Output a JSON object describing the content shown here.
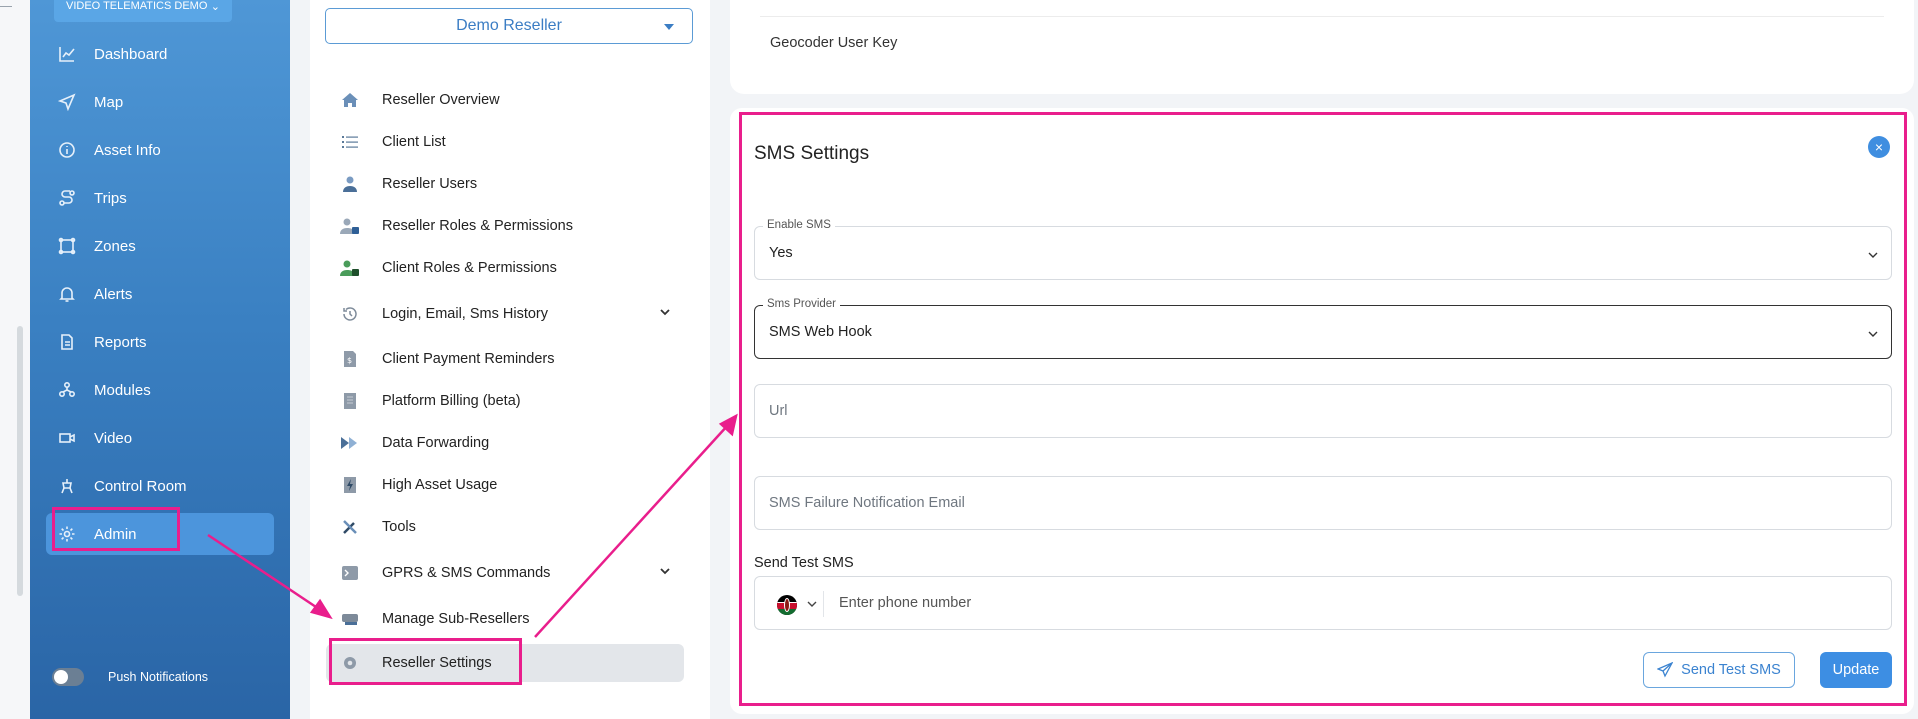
{
  "sidebar": {
    "top_select": "VIDEO TELEMATICS DEMO",
    "items": [
      {
        "label": "Dashboard",
        "icon": "chart-line-icon"
      },
      {
        "label": "Map",
        "icon": "navigation-icon"
      },
      {
        "label": "Asset Info",
        "icon": "info-icon"
      },
      {
        "label": "Trips",
        "icon": "route-icon"
      },
      {
        "label": "Zones",
        "icon": "zone-icon"
      },
      {
        "label": "Alerts",
        "icon": "bell-icon"
      },
      {
        "label": "Reports",
        "icon": "document-icon"
      },
      {
        "label": "Modules",
        "icon": "modules-icon"
      },
      {
        "label": "Video",
        "icon": "video-icon"
      },
      {
        "label": "Control Room",
        "icon": "control-room-icon"
      },
      {
        "label": "Admin",
        "icon": "gear-icon",
        "active": true
      }
    ],
    "push_notifications": "Push Notifications"
  },
  "menu": {
    "reseller": "Demo Reseller",
    "items": [
      {
        "label": "Reseller Overview",
        "icon": "home-icon"
      },
      {
        "label": "Client List",
        "icon": "list-icon"
      },
      {
        "label": "Reseller Users",
        "icon": "user-icon"
      },
      {
        "label": "Reseller Roles & Permissions",
        "icon": "user-lock-icon"
      },
      {
        "label": "Client Roles & Permissions",
        "icon": "user-lock-green-icon"
      },
      {
        "label": "Login, Email, Sms History",
        "icon": "history-icon",
        "expandable": true
      },
      {
        "label": "Client Payment Reminders",
        "icon": "invoice-icon"
      },
      {
        "label": "Platform Billing (beta)",
        "icon": "billing-icon"
      },
      {
        "label": "Data Forwarding",
        "icon": "forward-icon"
      },
      {
        "label": "High Asset Usage",
        "icon": "bolt-icon"
      },
      {
        "label": "Tools",
        "icon": "tools-icon"
      },
      {
        "label": "GPRS & SMS Commands",
        "icon": "terminal-icon",
        "expandable": true
      },
      {
        "label": "Manage Sub-Resellers",
        "icon": "sub-reseller-icon"
      },
      {
        "label": "Reseller Settings",
        "icon": "settings-icon",
        "active": true
      }
    ]
  },
  "top_panel": {
    "label": "Geocoder User Key"
  },
  "sms": {
    "title": "SMS Settings",
    "close": "×",
    "enable_label": "Enable SMS",
    "enable_value": "Yes",
    "provider_label": "Sms Provider",
    "provider_value": "SMS Web Hook",
    "url_placeholder": "Url",
    "failure_placeholder": "SMS Failure Notification Email",
    "send_test_label": "Send Test SMS",
    "phone_placeholder": "Enter phone number",
    "send_test_button": "Send Test SMS",
    "update_button": "Update"
  },
  "colors": {
    "accent": "#3d8ee3",
    "highlight": "#e91e8c",
    "sidebar": "#3a80c2"
  }
}
